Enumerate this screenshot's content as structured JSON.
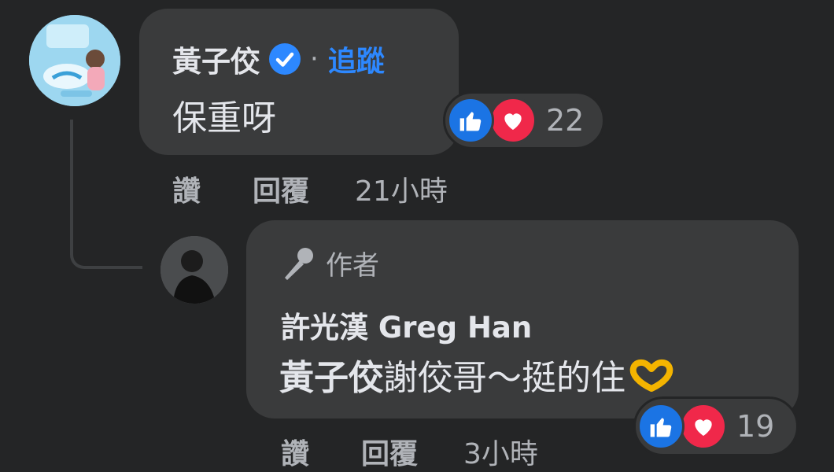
{
  "comment": {
    "author": "黃子佼",
    "follow_separator": "·",
    "follow_label": "追蹤",
    "text": "保重呀",
    "reaction_count": "22",
    "actions": {
      "like": "讚",
      "reply": "回覆"
    },
    "timestamp": "21小時"
  },
  "reply": {
    "badge_label": "作者",
    "author": "許光漢 Greg Han",
    "mention": "黃子佼",
    "text": " 謝佼哥～挺的住",
    "reaction_count": "19",
    "actions": {
      "like": "讚",
      "reply": "回覆"
    },
    "timestamp": "3小時"
  },
  "colors": {
    "background": "#242526",
    "bubble": "#3a3b3c",
    "link_blue": "#2d88ff",
    "like_blue": "#1b74e4",
    "love_red": "#f0284a",
    "secondary_text": "#b0b3b8"
  },
  "icons": [
    "verified-badge-icon",
    "microphone-icon",
    "like-reaction-icon",
    "love-reaction-icon",
    "heart-hands-emoji-icon"
  ]
}
